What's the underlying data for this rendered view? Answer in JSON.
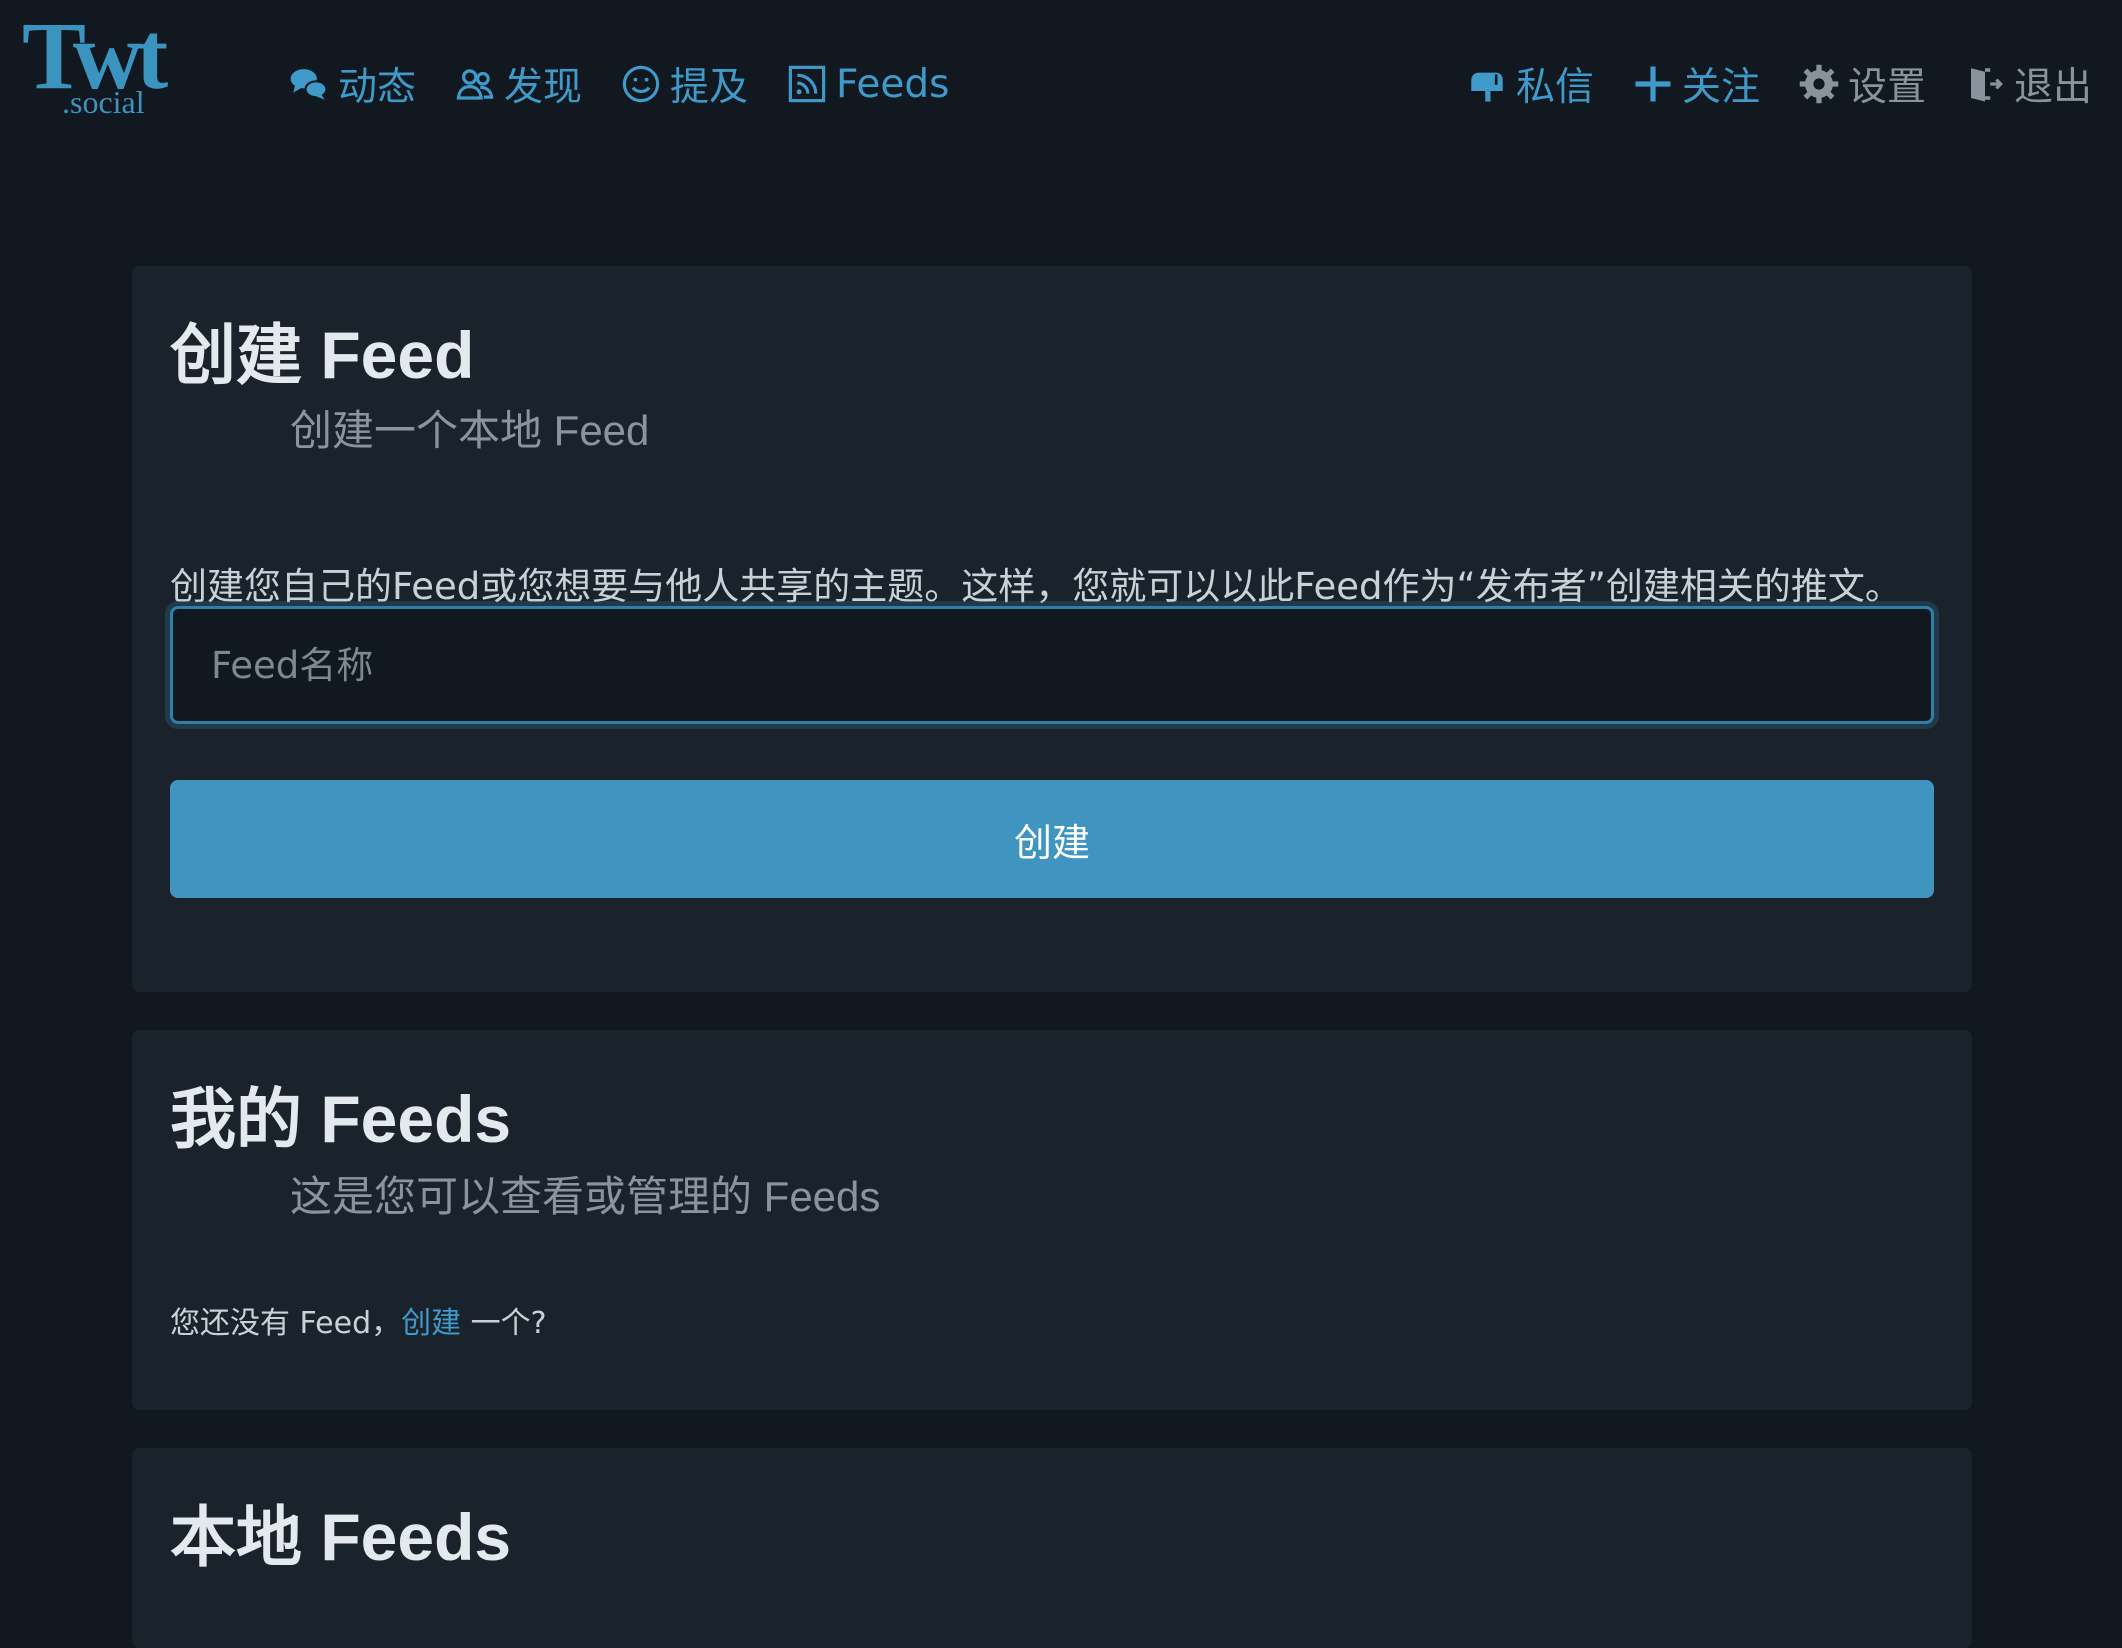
{
  "header": {
    "logo": {
      "main": "Twt",
      "sub": ".social"
    },
    "nav_left": [
      {
        "label": "动态",
        "icon": "chat-bubbles-icon"
      },
      {
        "label": "发现",
        "icon": "users-icon"
      },
      {
        "label": "提及",
        "icon": "smiley-icon"
      },
      {
        "label": "Feeds",
        "icon": "rss-icon"
      }
    ],
    "nav_right": [
      {
        "label": "私信",
        "icon": "mailbox-icon"
      },
      {
        "label": "关注",
        "icon": "plus-icon"
      },
      {
        "label": "设置",
        "icon": "gear-icon"
      },
      {
        "label": "退出",
        "icon": "door-exit-icon"
      }
    ]
  },
  "create_feed": {
    "title": "创建 Feed",
    "subtitle": "创建一个本地 Feed",
    "description": "创建您自己的Feed或您想要与他人共享的主题。这样，您就可以以此Feed作为“发布者”创建相关的推文。",
    "input_placeholder": "Feed名称",
    "input_value": "",
    "button_label": "创建"
  },
  "my_feeds": {
    "title": "我的 Feeds",
    "subtitle": "这是您可以查看或管理的 Feeds",
    "empty_prefix": "您还没有 Feed，",
    "empty_link": "创建",
    "empty_suffix": " 一个?"
  },
  "local_feeds": {
    "title": "本地 Feeds"
  },
  "colors": {
    "background": "#11181f",
    "card": "#1a232b",
    "accent": "#3f95c0",
    "muted": "#8a939c"
  }
}
